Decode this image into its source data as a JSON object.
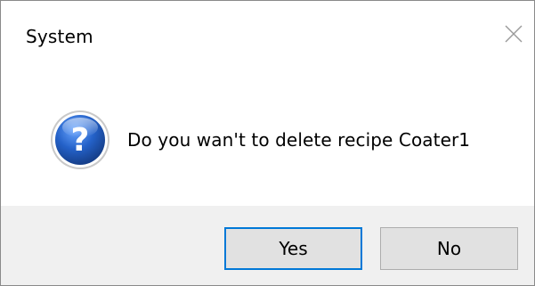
{
  "window": {
    "title": "System",
    "close_icon": "close-icon"
  },
  "message": {
    "icon": "question-icon",
    "text": "Do you wan't to delete recipe Coater1"
  },
  "buttons": {
    "yes_label": "Yes",
    "no_label": "No"
  },
  "colors": {
    "footer_background": "#f0f0f0",
    "button_background": "#e1e1e1",
    "default_button_border": "#0078d7",
    "question_icon_blue": "#1f5fbf"
  }
}
